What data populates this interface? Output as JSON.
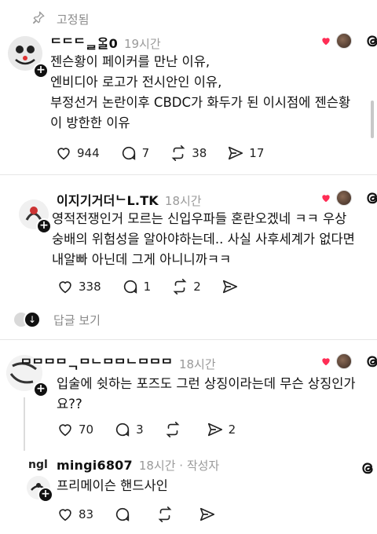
{
  "pinned": {
    "label": "고정됨",
    "icon": "pin-icon"
  },
  "posts": [
    {
      "username": "ᄃᄃᄃᆯᄋᆞᆯ0",
      "time": "19시간",
      "lines": [
        "젠슨황이 페이커를 만난 이유,",
        "엔비디아 로고가 전시안인 이유,",
        "부정선거 논란이후 CBDC가 화두가 된 이시점에 젠슨황",
        "이 방한한 이유"
      ],
      "likes": "944",
      "comments": "7",
      "reposts": "38",
      "shares": "17"
    },
    {
      "username": "이지기거더ᄂL.TK",
      "time": "18시간",
      "lines": [
        "영적전쟁인거 모르는 신입우파들 혼란오겠네 ㅋㅋ 우상",
        "숭배의 위험성을 알아야하는데.. 사실 사후세계가 없다면",
        "내알빠 아닌데 그게 아니니까ㅋㅋ"
      ],
      "likes": "338",
      "comments": "1",
      "reposts": "2",
      "shares": ""
    },
    {
      "username": "ᄆᄆᄆᄆᆨᄆᄂᄆᄆᄂᄆᄆᄆ",
      "time": "18시간",
      "lines": [
        "입술에 쉿하는 포즈도 그런 상징이라는데 무슨 상징인가",
        "요??"
      ],
      "likes": "70",
      "comments": "3",
      "reposts": "",
      "shares": "2"
    },
    {
      "username": "mingi6807",
      "time": "18시간 · 작성자",
      "lines": [
        "프리메이슨 핸드사인"
      ],
      "likes": "83",
      "comments": "",
      "reposts": "",
      "shares": ""
    }
  ],
  "view_replies": "답글 보기",
  "colors": {
    "heart": "#ff2d55",
    "muted": "#8a8a8a",
    "text": "#111111"
  }
}
